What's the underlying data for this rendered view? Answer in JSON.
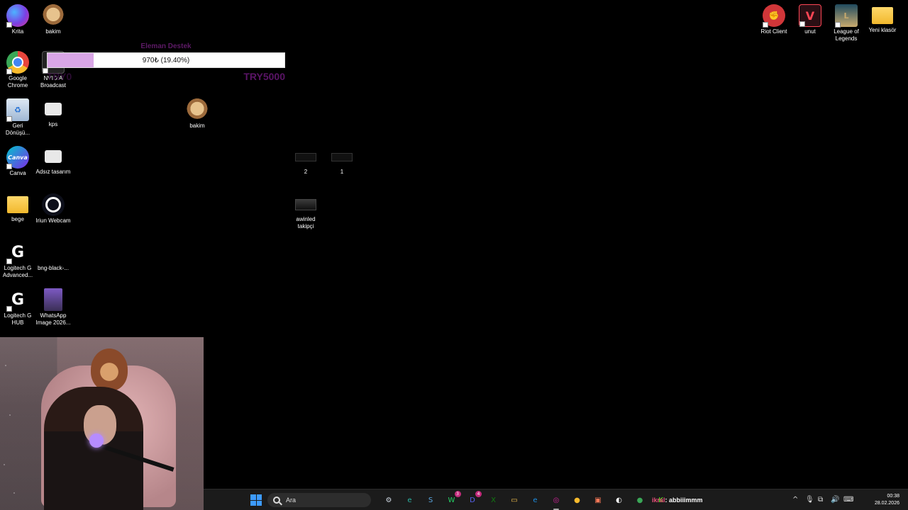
{
  "desktop": {
    "left_icons": [
      {
        "id": "krita",
        "label": "Krita",
        "icon": "krita-icon"
      },
      {
        "id": "bakim-1",
        "label": "bakim",
        "icon": "cat-image-icon"
      },
      {
        "id": "chrome",
        "label": "Google Chrome",
        "icon": "chrome-icon"
      },
      {
        "id": "nvidia",
        "label": "NVIDIA Broadcast",
        "icon": "nvidia-icon"
      },
      {
        "id": "recycle",
        "label": "Geri Dönüşü...",
        "icon": "recycle-bin-icon"
      },
      {
        "id": "kps",
        "label": "kps",
        "icon": "file-icon"
      },
      {
        "id": "canva",
        "label": "Canva",
        "icon": "canva-icon"
      },
      {
        "id": "adsiz",
        "label": "Adsız tasarım",
        "icon": "file-icon"
      },
      {
        "id": "bege",
        "label": "bege",
        "icon": "folder-icon"
      },
      {
        "id": "iriun",
        "label": "Iriun Webcam",
        "icon": "webcam-icon"
      },
      {
        "id": "logi-adv",
        "label": "Logitech G Advanced...",
        "icon": "logitech-icon"
      },
      {
        "id": "bng",
        "label": "bng-black-...",
        "icon": "image-icon"
      },
      {
        "id": "logi-hub",
        "label": "Logitech G HUB",
        "icon": "logitech-icon"
      },
      {
        "id": "whatsapp-img",
        "label": "WhatsApp Image 2026...",
        "icon": "photo-icon"
      }
    ],
    "mid_icons": [
      {
        "id": "bakim-2",
        "label": "bakim",
        "icon": "cat-image-icon"
      },
      {
        "id": "file-2",
        "label": "2",
        "icon": "blank-file-icon"
      },
      {
        "id": "file-1",
        "label": "1",
        "icon": "blank-file-icon"
      },
      {
        "id": "awinled",
        "label": "awinled takipçi",
        "icon": "thumbnail-icon"
      }
    ],
    "right_icons": [
      {
        "id": "riot",
        "label": "Riot Client",
        "icon": "riot-icon"
      },
      {
        "id": "unut",
        "label": "unut",
        "icon": "valorant-icon"
      },
      {
        "id": "lol",
        "label": "League of Legends",
        "icon": "league-icon"
      },
      {
        "id": "yeni",
        "label": "Yeni klasör",
        "icon": "folder-icon"
      }
    ]
  },
  "donation": {
    "title": "Eleman Destek",
    "progress_text": "970₺ (19.40%)",
    "progress": 0.194,
    "min_label": "TRY0",
    "max_label": "TRY5000"
  },
  "taskbar": {
    "search_placeholder": "Ara",
    "apps": [
      {
        "name": "settings-app",
        "glyph": "⚙",
        "color": "#cfd8e3"
      },
      {
        "name": "edge-app",
        "glyph": "e",
        "color": "#2bb3a3"
      },
      {
        "name": "steam-app",
        "glyph": "S",
        "color": "#5aa6e0"
      },
      {
        "name": "whatsapp-app",
        "glyph": "W",
        "color": "#25d366",
        "badge": "3"
      },
      {
        "name": "discord-app",
        "glyph": "D",
        "color": "#5865f2",
        "badge": "4"
      },
      {
        "name": "xbox-app",
        "glyph": "X",
        "color": "#107c10"
      },
      {
        "name": "explorer-app",
        "glyph": "▭",
        "color": "#f2c14e"
      },
      {
        "name": "edge-beta-app",
        "glyph": "e",
        "color": "#1d8fe3"
      },
      {
        "name": "instagram-app",
        "glyph": "◎",
        "color": "#d6249f"
      },
      {
        "name": "chrome-app",
        "glyph": "●",
        "color": "#f9bb2d"
      },
      {
        "name": "photos-app",
        "glyph": "▣",
        "color": "#ff7a59"
      },
      {
        "name": "obs-app",
        "glyph": "◐",
        "color": "#ffffff"
      },
      {
        "name": "chrome-alt-app",
        "glyph": "●",
        "color": "#3aa757"
      },
      {
        "name": "kick-app",
        "glyph": "K",
        "color": "#53fc18"
      }
    ],
    "chat_user": "ikral",
    "chat_message": ": abbiiimmm",
    "tray": [
      "^",
      "🎙",
      "⧉",
      "🔊",
      "⌨"
    ],
    "time": "00:38",
    "date": "28.02.2026"
  }
}
